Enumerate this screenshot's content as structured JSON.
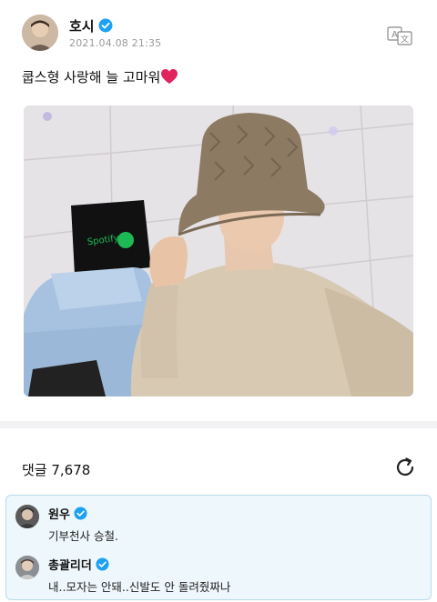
{
  "post": {
    "author": "호시",
    "timestamp": "2021.04.08 21:35",
    "text": "쿱스형 사랑해 늘 고마워",
    "emoji": "heart-emoji",
    "translate_icon": "translate-icon"
  },
  "comments_section": {
    "label": "댓글 7,678",
    "refresh_icon": "refresh-icon"
  },
  "comments": [
    {
      "name": "원우",
      "text": "기부천사 승철."
    },
    {
      "name": "총괄리더",
      "text": "내..모자는 안돼..신발도 안 돌려줬짜나"
    }
  ],
  "colors": {
    "verified": "#1da1f2",
    "heart": "#e0245e",
    "comment_box_bg": "#eef7fb",
    "comment_box_border": "#b8dbea",
    "divider": "#f2f2f4"
  }
}
